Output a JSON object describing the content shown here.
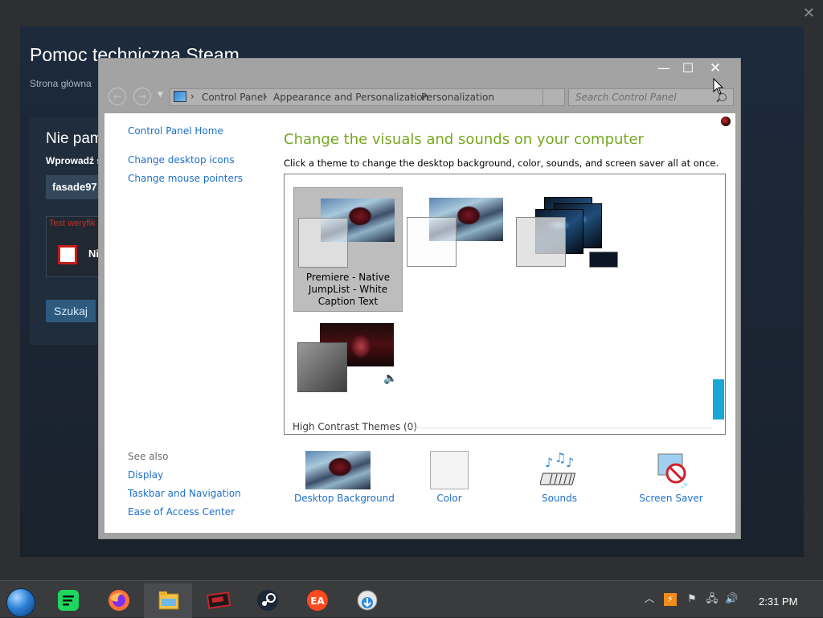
{
  "steam": {
    "title": "Pomoc techniczna Steam",
    "breadcrumb": "Strona główna",
    "heading": "Nie pam",
    "enter_label": "Wprowadź s",
    "input_value": "fasade97",
    "captcha_error": "Test weryfik powtórnie p",
    "captcha_text": "Ni",
    "search_button": "Szukaj",
    "close": "✕"
  },
  "window": {
    "minimize": "—",
    "maximize": "☐",
    "close": "✕",
    "address": {
      "crumbs": [
        "Control Panel",
        "Appearance and Personalization",
        "Personalization"
      ],
      "separator": "›"
    },
    "search_placeholder": "Search Control Panel"
  },
  "left_nav": {
    "home": "Control Panel Home",
    "links": [
      "Change desktop icons",
      "Change mouse pointers"
    ],
    "see_also_title": "See also",
    "see_also": [
      "Display",
      "Taskbar and Navigation",
      "Ease of Access Center"
    ]
  },
  "main": {
    "heading": "Change the visuals and sounds on your computer",
    "description": "Click a theme to change the desktop background, color, sounds, and screen saver all at once.",
    "themes": [
      {
        "label": "Premiere - Native JumpList - White Caption Text",
        "selected": true
      },
      {
        "label": "",
        "selected": false
      },
      {
        "label": "",
        "selected": false
      },
      {
        "label": "",
        "selected": false
      }
    ],
    "high_contrast_label": "High Contrast Themes (0)"
  },
  "bottom_items": {
    "desktop_background": "Desktop Background",
    "color": "Color",
    "sounds": "Sounds",
    "screen_saver": "Screen Saver"
  },
  "taskbar": {
    "apps": [
      "spotify-icon",
      "firefox-icon",
      "file-explorer-icon",
      "game-icon",
      "steam-icon",
      "ea-icon",
      "setup-icon"
    ],
    "active": [
      "file-explorer-icon"
    ],
    "clock": "2:31 PM"
  },
  "colors": {
    "heading_green": "#75a81f",
    "link_blue": "#1e70c8",
    "scroll_accent": "#19a7d8",
    "steam_button": "#2e5a7e",
    "error_red": "#d2281c"
  }
}
